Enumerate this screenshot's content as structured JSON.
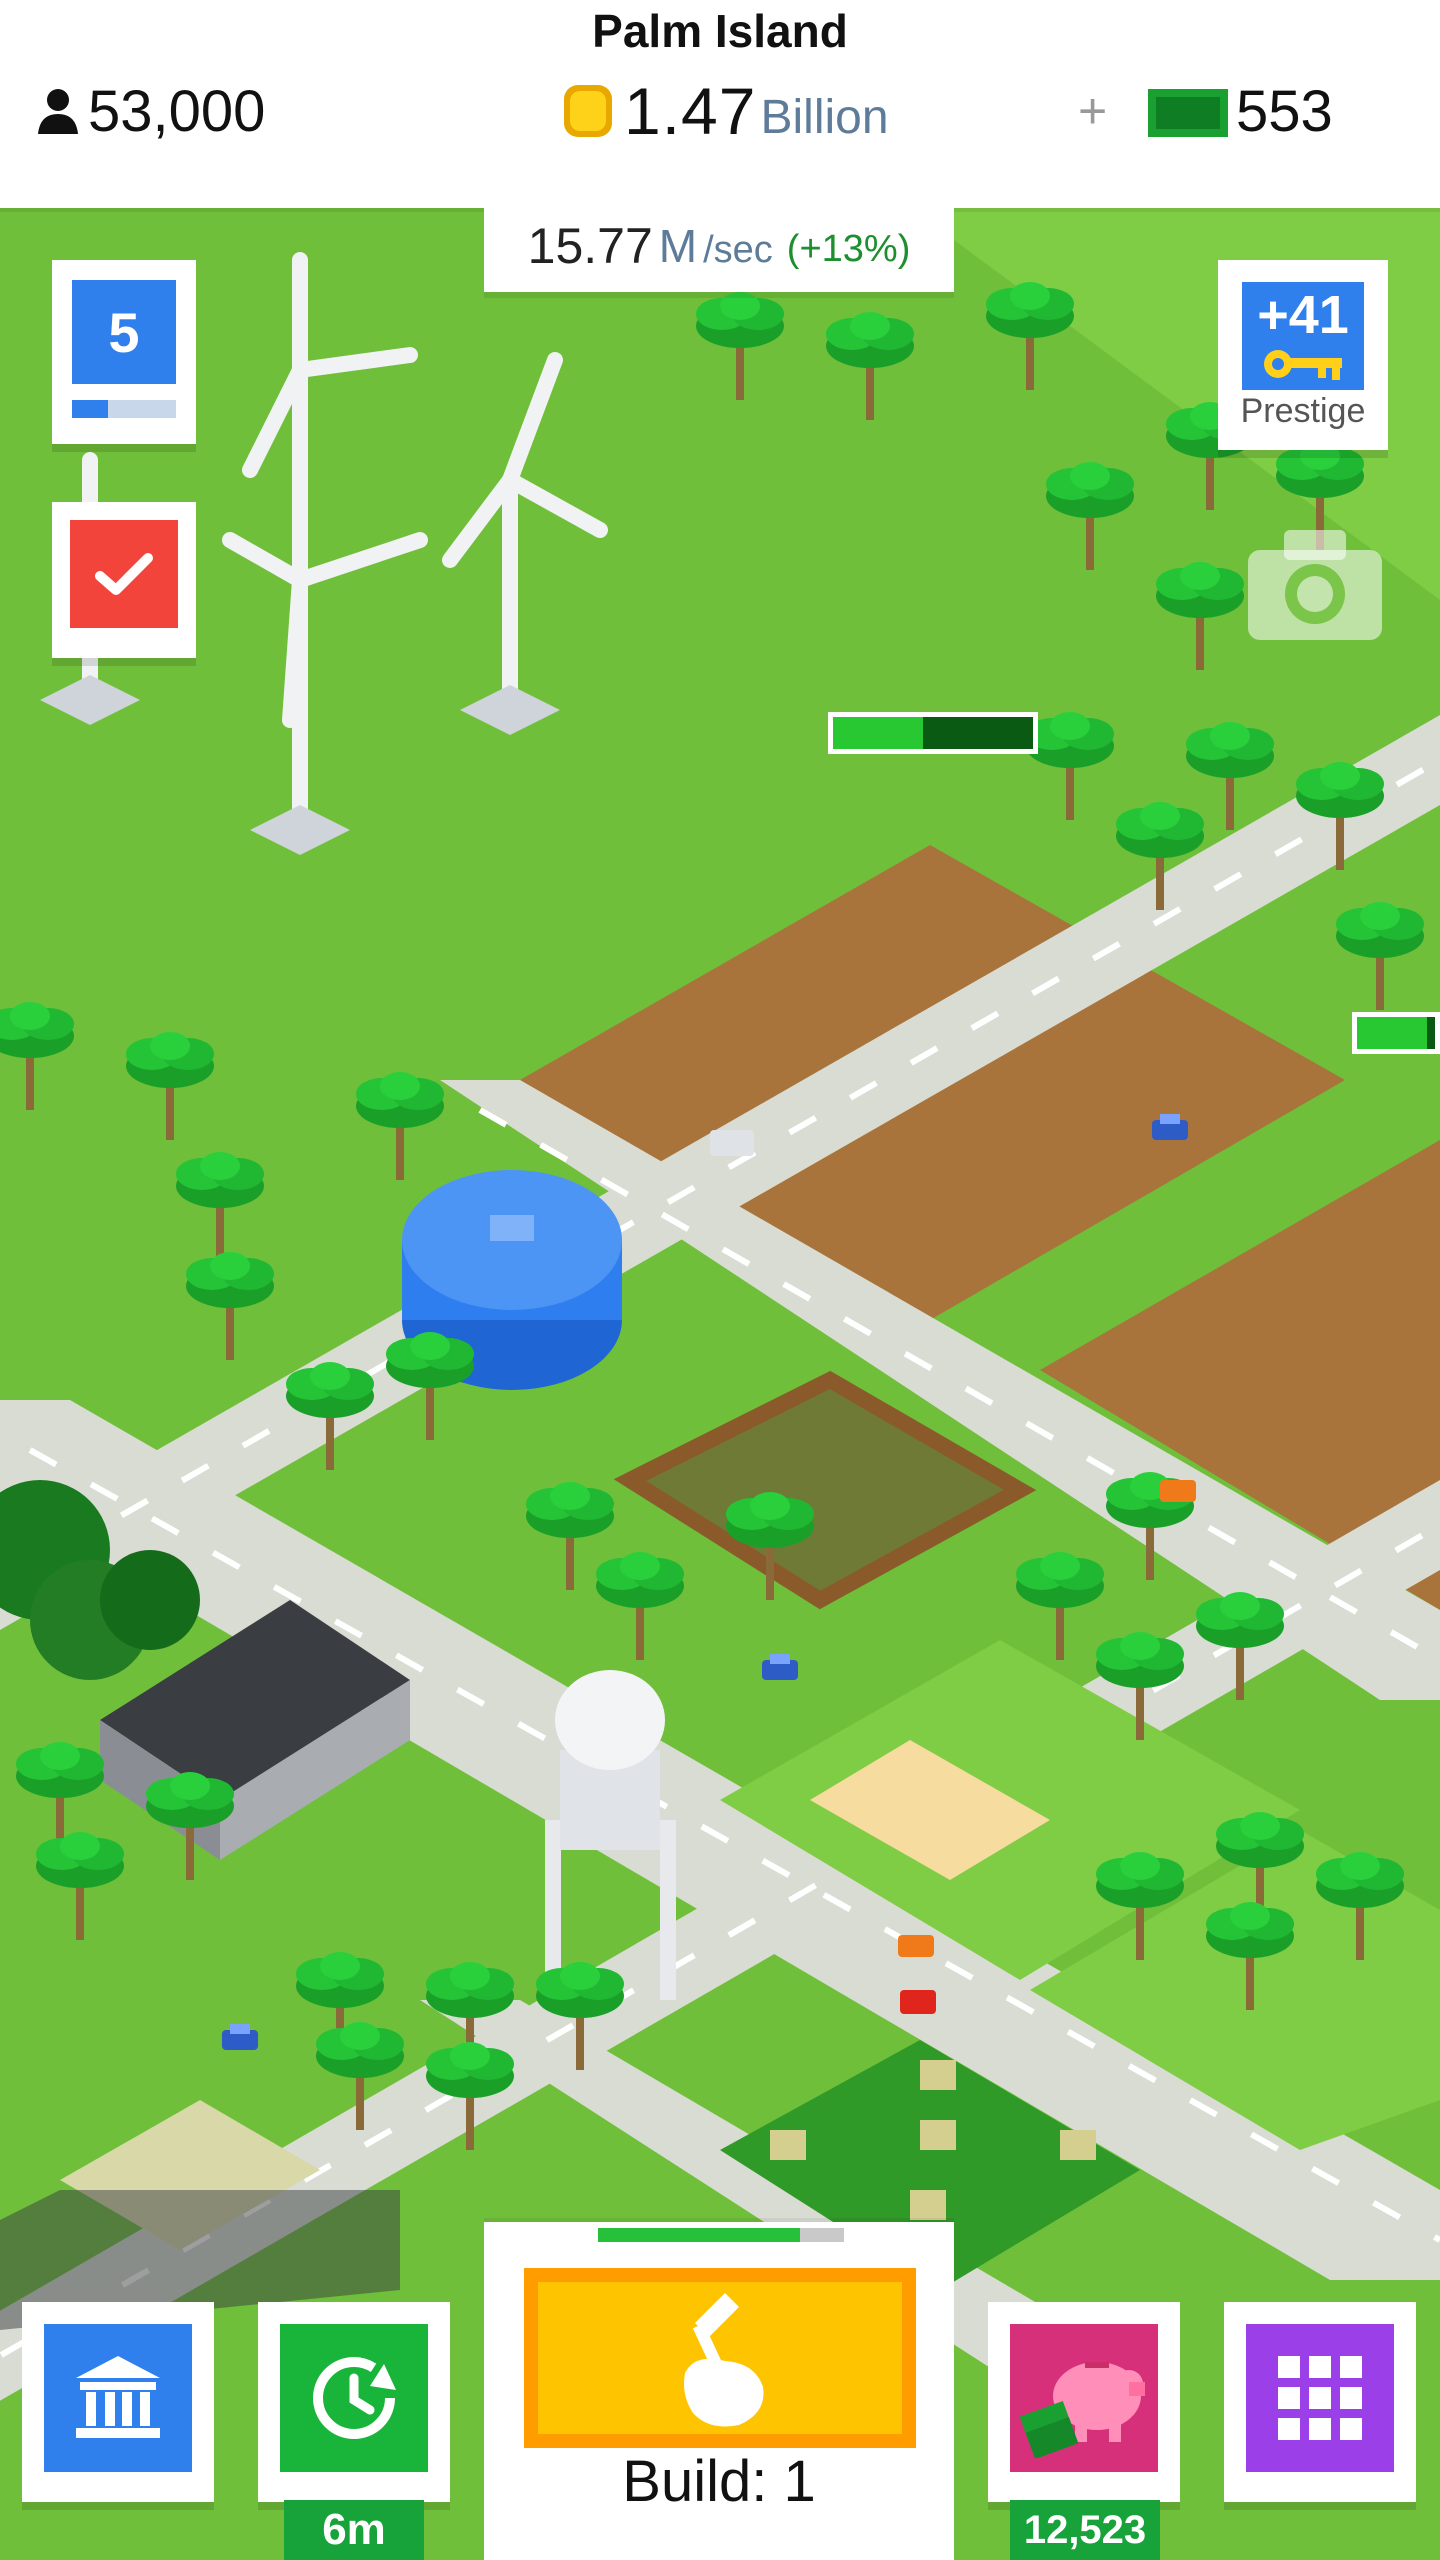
{
  "header": {
    "island_name": "Palm Island",
    "population": "53,000",
    "coins_value": "1.47",
    "coins_unit": "Billion",
    "plus_label": "+",
    "cash_value": "553"
  },
  "income": {
    "value": "15.77",
    "unit": "M",
    "per": "/sec",
    "bonus": "(+13%)"
  },
  "level": {
    "number": "5",
    "progress_fraction": 0.35
  },
  "prestige": {
    "count": "+41",
    "label": "Prestige"
  },
  "map_bars": {
    "windfarm_progress": 0.45,
    "edge_progress": 0.9
  },
  "build": {
    "label": "Build: 1",
    "progress_fraction": 0.82
  },
  "boost": {
    "timer": "6m"
  },
  "piggy_bank": {
    "count": "12,523"
  },
  "colors": {
    "grass": "#6fbf3a",
    "road": "#d9dcd2",
    "dirt": "#a8743b",
    "accent_blue": "#2f80ed",
    "build_orange": "#ff9d00",
    "build_yellow": "#ffc400",
    "status_green": "#17a33a",
    "purple": "#9b3fe8",
    "pink": "#d6307a",
    "red": "#f2443a"
  },
  "icons": {
    "population": "person-icon",
    "coin": "coin-icon",
    "cash": "cash-icon",
    "tasks": "checkmark-icon",
    "key": "key-icon",
    "camera": "camera-icon",
    "bank": "bank-icon",
    "boost": "clock-refresh-icon",
    "build": "hammer-hand-icon",
    "piggy": "piggy-bank-icon",
    "menu": "grid-icon"
  }
}
